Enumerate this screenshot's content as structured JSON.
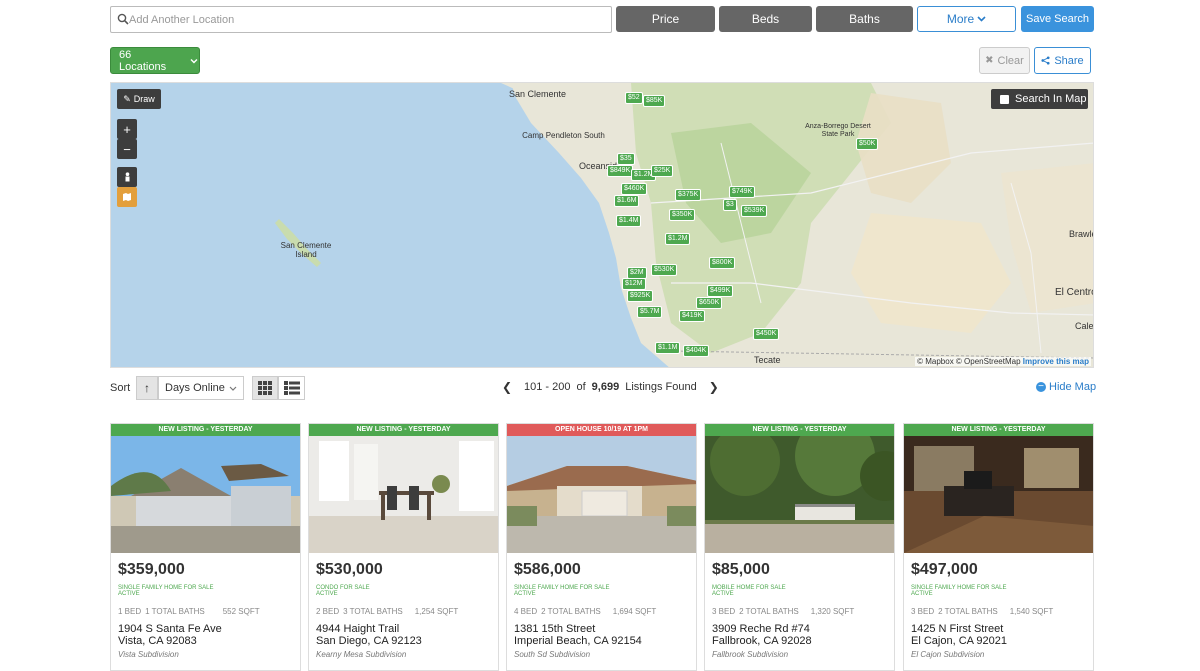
{
  "search": {
    "placeholder": "Add Another Location"
  },
  "filters": {
    "price": "Price",
    "beds": "Beds",
    "baths": "Baths",
    "more": "More",
    "save": "Save Search"
  },
  "locations": {
    "label": "66 Locations"
  },
  "actions": {
    "clear": "Clear",
    "share": "Share"
  },
  "map": {
    "draw": "Draw",
    "zoom_in": "+",
    "zoom_out": "−",
    "search_in_map": "Search In Map",
    "places": [
      "San Clemente",
      "Camp Pendleton South",
      "Oceanside",
      "San Clemente Island",
      "Anza-Borrego Desert State Park",
      "Tecate",
      "El Centro",
      "Brawley",
      "Calexico"
    ],
    "attribution": {
      "mapbox": "© Mapbox",
      "osm": "© OpenStreetMap",
      "improve": "Improve this map"
    },
    "pins": [
      "$52",
      "$85K",
      "$50K",
      "$849K",
      "$1.2M",
      "$460K",
      "$375K",
      "$749K",
      "$1.6M",
      "$350K",
      "$539K",
      "$1.4M",
      "$1.2M",
      "$800K",
      "$2M",
      "$530K",
      "$12M",
      "$925K",
      "$499K",
      "$650K",
      "$5.7M",
      "$419K",
      "$450K",
      "$1.1M",
      "$404K",
      "$25K",
      "$3",
      "$35"
    ]
  },
  "sort": {
    "label": "Sort",
    "direction": "↑",
    "field": "Days Online"
  },
  "pager": {
    "range": "101 - 200",
    "of": "of",
    "total": "9,699",
    "suffix": "Listings Found"
  },
  "hide_map": "Hide Map",
  "listings": [
    {
      "banner": "NEW LISTING - YESTERDAY",
      "banner_color": "green",
      "price": "$359,000",
      "type": "SINGLE FAMILY HOME FOR SALE",
      "status": "ACTIVE",
      "beds": "1 BED",
      "baths": "1 TOTAL BATHS",
      "sqft": "552 SQFT",
      "addr1": "1904 S Santa Fe Ave",
      "addr2": "Vista, CA 92083",
      "subdivision": "Vista Subdivision"
    },
    {
      "banner": "NEW LISTING - YESTERDAY",
      "banner_color": "green",
      "price": "$530,000",
      "type": "CONDO FOR SALE",
      "status": "ACTIVE",
      "beds": "2 BED",
      "baths": "3 TOTAL BATHS",
      "sqft": "1,254 SQFT",
      "addr1": "4944 Haight Trail",
      "addr2": "San Diego, CA 92123",
      "subdivision": "Kearny Mesa Subdivision"
    },
    {
      "banner": "OPEN HOUSE 10/19 AT 1PM",
      "banner_color": "red",
      "price": "$586,000",
      "type": "SINGLE FAMILY HOME FOR SALE",
      "status": "ACTIVE",
      "beds": "4 BED",
      "baths": "2 TOTAL BATHS",
      "sqft": "1,694 SQFT",
      "addr1": "1381 15th Street",
      "addr2": "Imperial Beach, CA 92154",
      "subdivision": "South Sd Subdivision"
    },
    {
      "banner": "NEW LISTING - YESTERDAY",
      "banner_color": "green",
      "price": "$85,000",
      "type": "MOBILE HOME FOR SALE",
      "status": "ACTIVE",
      "beds": "3 BED",
      "baths": "2 TOTAL BATHS",
      "sqft": "1,320 SQFT",
      "addr1": "3909 Reche Rd #74",
      "addr2": "Fallbrook, CA 92028",
      "subdivision": "Fallbrook Subdivision"
    },
    {
      "banner": "NEW LISTING - YESTERDAY",
      "banner_color": "green",
      "price": "$497,000",
      "type": "SINGLE FAMILY HOME FOR SALE",
      "status": "ACTIVE",
      "beds": "3 BED",
      "baths": "2 TOTAL BATHS",
      "sqft": "1,540 SQFT",
      "addr1": "1425 N First Street",
      "addr2": "El Cajon, CA 92021",
      "subdivision": "El Cajon Subdivision"
    }
  ]
}
